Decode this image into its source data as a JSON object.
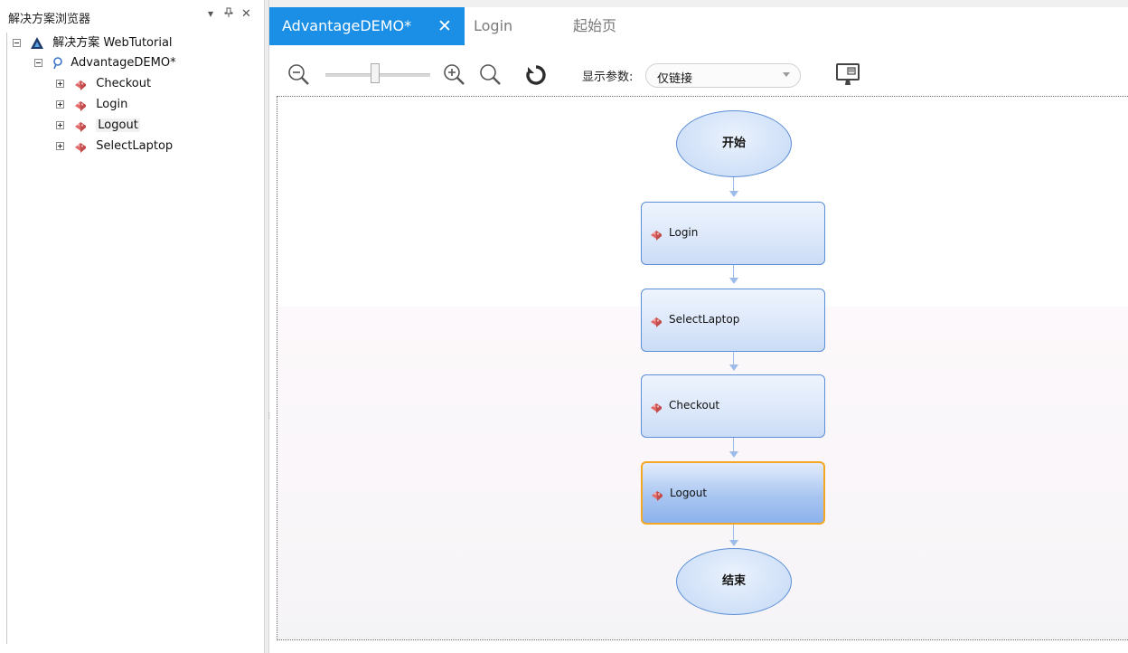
{
  "explorer": {
    "title": "解决方案浏览器",
    "pin_glyph": "▾ ⫰",
    "close_glyph": "✕",
    "solution_label": "解决方案 WebTutorial",
    "project_label": "AdvantageDEMO*",
    "actions": [
      {
        "label": "Checkout"
      },
      {
        "label": "Login"
      },
      {
        "label": "Logout",
        "selected": true
      },
      {
        "label": "SelectLaptop"
      }
    ]
  },
  "tabs": [
    {
      "label": "AdvantageDEMO*",
      "active": true,
      "close": "✕"
    },
    {
      "label": "Login",
      "active": false
    },
    {
      "label": "起始页",
      "active": false
    }
  ],
  "toolbar": {
    "zoom_level": 0.47,
    "param_label": "显示参数:",
    "param_value": "仅链接",
    "icons": [
      "zoom-out-icon",
      "zoom-in-icon",
      "zoom-fit-icon",
      "refresh-icon",
      "monitor-icon"
    ]
  },
  "flow": {
    "start": "开始",
    "end": "结束",
    "steps": [
      {
        "label": "Login"
      },
      {
        "label": "SelectLaptop"
      },
      {
        "label": "Checkout"
      },
      {
        "label": "Logout",
        "selected": true
      }
    ]
  },
  "colors": {
    "tab_active_bg": "#1b8fe6",
    "box_border": "#5c8fd6",
    "selected_border": "#f5a623",
    "action_icon": "#e06a6a",
    "refresh_icon": "#2c2c2c"
  }
}
